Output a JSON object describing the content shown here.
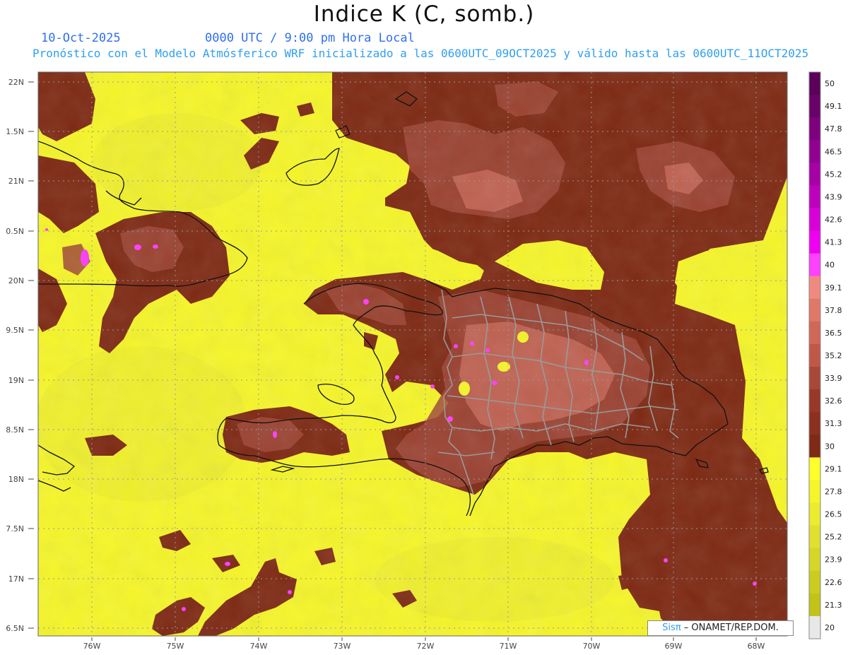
{
  "header": {
    "title": "Indice K (C, somb.)",
    "date": "10-Oct-2025",
    "time": "0000 UTC / 9:00 pm Hora Local",
    "forecast": "Pronóstico con el Modelo Atmósferico WRF inicializado a las 0600UTC_09OCT2025 y válido hasta las  0600UTC_11OCT2025"
  },
  "map": {
    "lat_labels": [
      "22N",
      "1.5N",
      "21N",
      "0.5N",
      "20N",
      "9.5N",
      "19N",
      "8.5N",
      "18N",
      "7.5N",
      "17N",
      "6.5N"
    ],
    "lon_labels": [
      "76W",
      "75W",
      "74W",
      "73W",
      "72W",
      "71W",
      "70W",
      "69W",
      "68W"
    ],
    "lat_range": [
      16.5,
      22.0
    ],
    "lon_range": [
      -76.6,
      -67.6
    ],
    "field": "Indice K",
    "units": "C"
  },
  "colorbar": {
    "levels": [
      "50",
      "49.1",
      "47.8",
      "46.5",
      "45.2",
      "43.9",
      "42.6",
      "41.3",
      "40",
      "39.1",
      "37.8",
      "36.5",
      "35.2",
      "33.9",
      "32.6",
      "31.3",
      "30",
      "29.1",
      "27.8",
      "26.5",
      "25.2",
      "23.9",
      "22.6",
      "21.3",
      "20"
    ],
    "colors": [
      "#5a005a",
      "#6a006a",
      "#7e007e",
      "#920092",
      "#a600a6",
      "#be00be",
      "#d800d8",
      "#f000f0",
      "#ff40ff",
      "#f08a80",
      "#e07868",
      "#d06858",
      "#c05848",
      "#a84838",
      "#983828",
      "#8c3020",
      "#7e2a14",
      "#ffff2a",
      "#f5f52a",
      "#ebeb30",
      "#e0e030",
      "#d6d628",
      "#cccc20",
      "#c2c218",
      "#e8e8e8"
    ]
  },
  "credit": {
    "prefix": "Sis",
    "pi": "π",
    "suffix": "– ONAMET/REP.DOM."
  }
}
